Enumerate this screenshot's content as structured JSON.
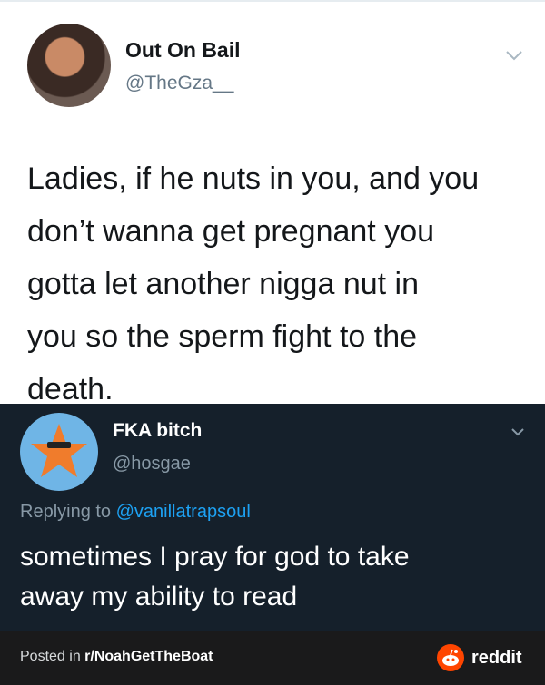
{
  "tweet1": {
    "display_name": "Out On Bail",
    "handle": "@TheGza__",
    "lines": [
      "Ladies, if he nuts in you, and you",
      "don’t wanna get pregnant you",
      "gotta let another nigga nut in",
      "you so the sperm fight to the",
      "death."
    ]
  },
  "tweet2": {
    "display_name": "FKA bitch",
    "handle": "@hosgae",
    "replying_prefix": "Replying to ",
    "replying_handle": "@vanillatrapsoul",
    "lines": [
      "sometimes I pray for god to take",
      "away my ability to read"
    ]
  },
  "footer": {
    "posted_prefix": "Posted in ",
    "subreddit": "r/NoahGetTheBoat",
    "brand": "reddit"
  },
  "colors": {
    "dark_bg": "#15202b",
    "link_blue": "#1da1f2",
    "reddit_orange": "#ff4500",
    "footer_bg": "#1a1a1b"
  }
}
